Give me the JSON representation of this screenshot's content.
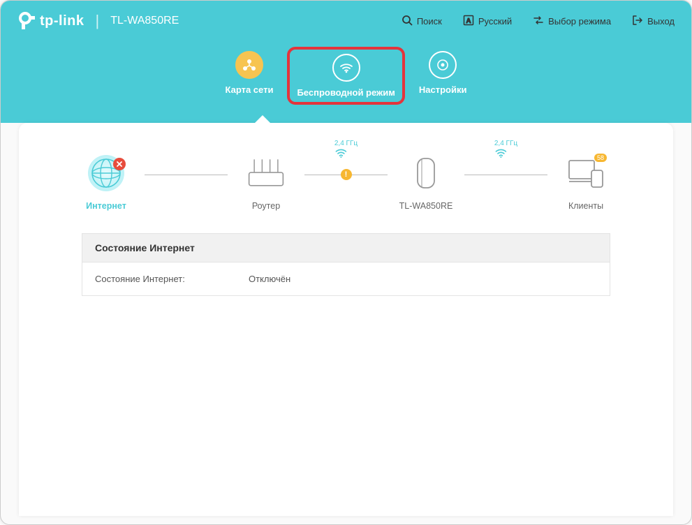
{
  "header": {
    "brand": "tp-link",
    "model": "TL-WA850RE"
  },
  "topbar": {
    "search": "Поиск",
    "lang": "Русский",
    "mode": "Выбор режима",
    "exit": "Выход"
  },
  "tabs": {
    "network_map": "Карта сети",
    "wireless": "Беспроводной режим",
    "settings": "Настройки"
  },
  "diagram": {
    "internet": "Интернет",
    "router": "Роутер",
    "extender": "TL-WA850RE",
    "clients": "Клиенты",
    "clients_count": "58",
    "freq1": "2,4 ГГц",
    "freq2": "2,4 ГГц"
  },
  "status": {
    "title": "Состояние Интернет",
    "key": "Состояние Интернет:",
    "value": "Отключён"
  }
}
